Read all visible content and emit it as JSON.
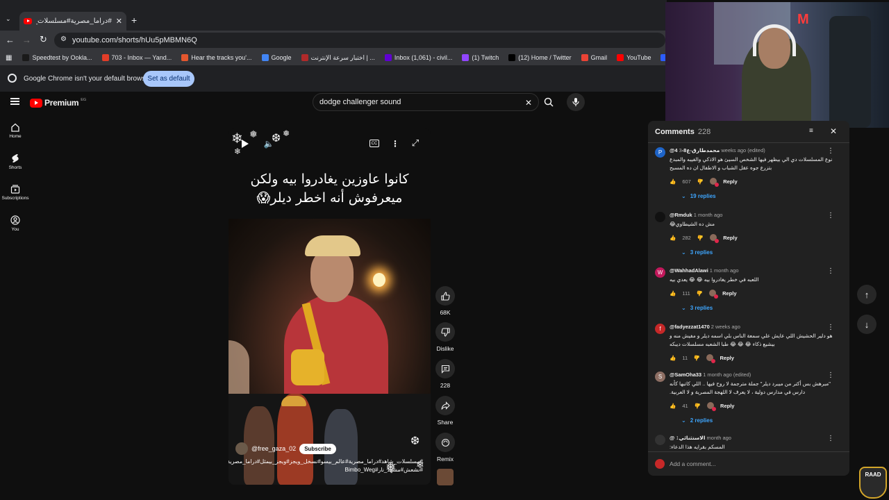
{
  "browser": {
    "tab_title": "#دراما_مصرية#مسلسلات_شاهد#",
    "url": "youtube.com/shorts/hUu5pMBMN6Q",
    "bookmarks": [
      {
        "label": "Speedtest by Ookla...",
        "color": "#1a1a1a"
      },
      {
        "label": "703 - Inbox — Yand...",
        "color": "#e23d28"
      },
      {
        "label": "Hear the tracks you'...",
        "color": "#e4572e"
      },
      {
        "label": "Google",
        "color": "#4285f4"
      },
      {
        "label": "اختبار سرعة الإنترنت | ...",
        "color": "#b02a2a"
      },
      {
        "label": "Inbox (1,061) - civil...",
        "color": "#6001d2"
      },
      {
        "label": "(1) Twitch",
        "color": "#9146ff"
      },
      {
        "label": "(12) Home / Twitter",
        "color": "#000000"
      },
      {
        "label": "Gmail",
        "color": "#ea4335"
      },
      {
        "label": "YouTube",
        "color": "#ff0000"
      },
      {
        "label": "Dashboard - Restre...",
        "color": "#2c5cff"
      }
    ],
    "infobar_text": "Google Chrome isn't your default browser",
    "set_default_label": "Set as default"
  },
  "youtube": {
    "logo_text": "Premium",
    "region": "EG",
    "search_value": "dodge challenger sound",
    "guide": [
      {
        "label": "Home",
        "icon": "home-icon"
      },
      {
        "label": "Shorts",
        "icon": "shorts-icon"
      },
      {
        "label": "Subscriptions",
        "icon": "subscriptions-icon"
      },
      {
        "label": "You",
        "icon": "you-icon"
      }
    ]
  },
  "short": {
    "caption_line1": "كانوا عاوزين يغادروا بيه ولكن",
    "caption_line2": "ميعرفوش أنه اخطر ديلر😱",
    "channel": "@free_gaza_02",
    "subscribe_label": "Subscribe",
    "description": "#مسلسلات_شاهد#دراما_مصرية#عالم_بيسو#نسخل_ويجز#ويجز_بيمثل#دراما_مصرية#نشعش_وخطر #نشعش#مشهد_نار#Bimbo_Weg",
    "actions": [
      {
        "label": "68K",
        "icon": "like-icon"
      },
      {
        "label": "Dislike",
        "icon": "dislike-icon"
      },
      {
        "label": "228",
        "icon": "comment-icon"
      },
      {
        "label": "Share",
        "icon": "share-icon"
      },
      {
        "label": "Remix",
        "icon": "remix-icon"
      }
    ]
  },
  "comments_panel": {
    "title": "Comments",
    "count": "228",
    "add_placeholder": "Add a comment...",
    "comments": [
      {
        "author": "@محمدطارق-ع8-4",
        "time": "3 weeks ago (edited)",
        "text": "نوع المسلسلات دي الي بيظهر فيها الشخص السيئ هو الاذكي والفيبه والمبدع بتزرع جوه عقل الشباب و الاطفال ان ده المسبح",
        "likes": "607",
        "replies": "19 replies",
        "avatar_letter": "P",
        "avatar_color": "#1e64c8"
      },
      {
        "author": "@Rmduk",
        "time": "1 month ago",
        "text": "مش ده الشيطاوي😂",
        "likes": "282",
        "replies": "3 replies",
        "avatar_letter": "",
        "avatar_color": "#111111"
      },
      {
        "author": "@WahhadAlawi",
        "time": "1 month ago",
        "text": "اللعبه في خطر يغادروا بيه 😂 😂 يعدي بيه",
        "likes": "111",
        "replies": "3 replies",
        "avatar_letter": "W",
        "avatar_color": "#c2185b"
      },
      {
        "author": "@fadyezzat1470",
        "time": "2 weeks ago",
        "text": "هو دلير الحشيش اللي عايش علي سمعة الناس بلي اسمه ديلر و مفيش منه و بيشيع ذكاء 😂 😂 😂 طبا الشعبه مسلسلات ديبكه",
        "likes": "11",
        "replies": "",
        "avatar_letter": "f",
        "avatar_color": "#c62828"
      },
      {
        "author": "@SamOha33",
        "time": "1 month ago (edited)",
        "text": "\"مبرهش بس أكتر من ميبرد ديلر\" جملة مترجمة لا روح فيها .. اللي كاتبها كأنه دارس في مدارس دولية ، لا يعرف لا اللهجة المصرية و لا العربية.",
        "likes": "41",
        "replies": "2 replies",
        "avatar_letter": "S",
        "avatar_color": "#8d6e63"
      },
      {
        "author": "@الاستثنائي",
        "time": "1 month ago",
        "text": "المسكم بقرايه هذا الدعاء:",
        "likes": "",
        "replies": "",
        "avatar_letter": "",
        "avatar_color": "#333333"
      }
    ],
    "reply_label": "Reply"
  },
  "colors": {
    "accent_blue": "#3ea6ff",
    "youtube_red": "#ff0000"
  }
}
